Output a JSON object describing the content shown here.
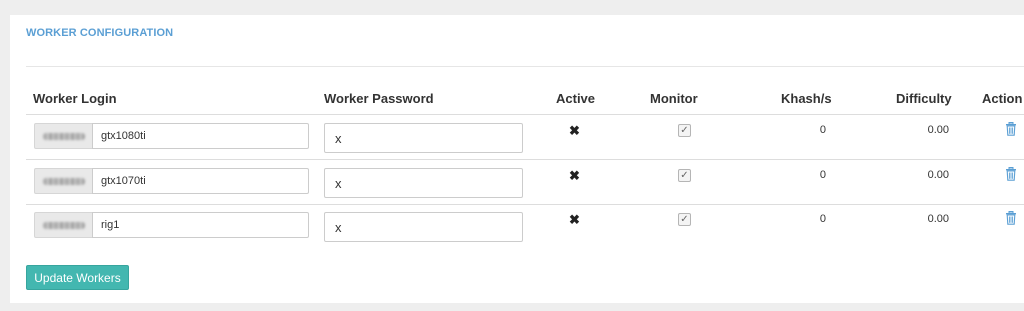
{
  "panel": {
    "title": "WORKER CONFIGURATION"
  },
  "table": {
    "columns": {
      "login": "Worker Login",
      "password": "Worker Password",
      "active": "Active",
      "monitor": "Monitor",
      "khash": "Khash/s",
      "difficulty": "Difficulty",
      "action": "Action"
    },
    "rows": [
      {
        "login_suffix": "gtx1080ti",
        "password": "x",
        "active_symbol": "✖",
        "monitor_checked": true,
        "monitor_symbol": "✓",
        "khash": "0",
        "difficulty": "0.00",
        "action_icon": "trash-icon"
      },
      {
        "login_suffix": "gtx1070ti",
        "password": "x",
        "active_symbol": "✖",
        "monitor_checked": true,
        "monitor_symbol": "✓",
        "khash": "0",
        "difficulty": "0.00",
        "action_icon": "trash-icon"
      },
      {
        "login_suffix": "rig1",
        "password": "x",
        "active_symbol": "✖",
        "monitor_checked": true,
        "monitor_symbol": "✓",
        "khash": "0",
        "difficulty": "0.00",
        "action_icon": "trash-icon"
      }
    ]
  },
  "buttons": {
    "update": "Update Workers"
  },
  "colors": {
    "title": "#5b9fd4",
    "button": "#43b7b0",
    "trash": "#5b9fd4"
  }
}
